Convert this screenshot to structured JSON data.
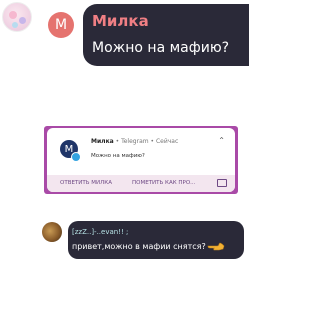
{
  "top_message": {
    "avatar_letter": "М",
    "sender": "Милка",
    "text": "Можно на мафию?"
  },
  "notification": {
    "avatar_letter": "М",
    "sender": "Милка",
    "app": "Telegram",
    "time": "Сейчас",
    "separator": "•",
    "message": "Можно на мафию?",
    "actions": [
      "ОТВЕТИТЬ МИЛКА",
      "ПОМЕТИТЬ КАК ПРО..."
    ]
  },
  "bottom_message": {
    "sender": "[zzZ..]-..evan!! ;",
    "text": "привет,можно в мафии снятся?"
  },
  "colors": {
    "bubble": "#2a2938",
    "top_sender": "#f07f84",
    "bottom_sender": "#b6e2e5",
    "avatar_m": "#e5736f",
    "card_border": "#a94aa7",
    "telegram_badge": "#33a3e0"
  }
}
